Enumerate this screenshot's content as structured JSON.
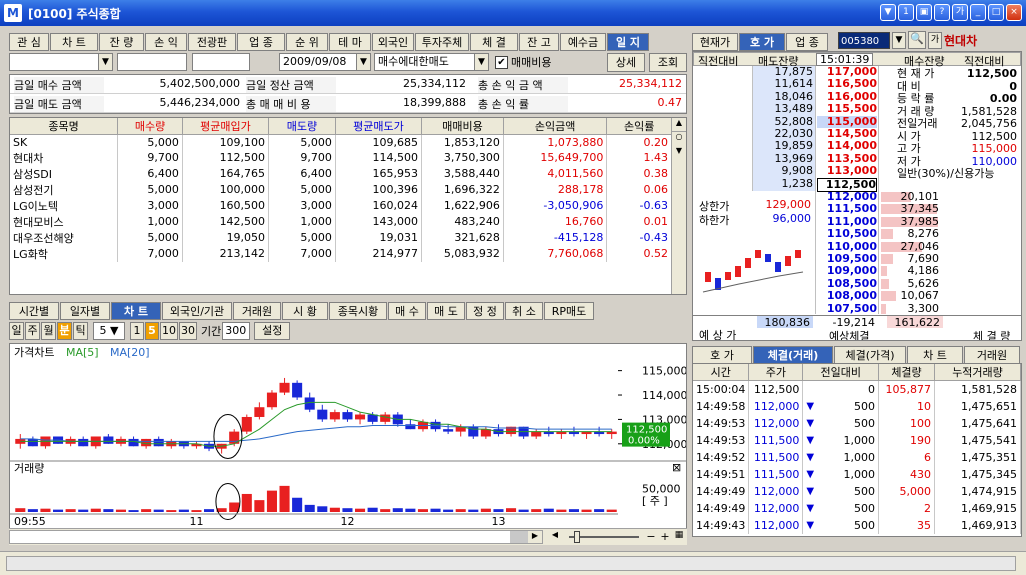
{
  "window": {
    "title": "[0100] 주식종합",
    "logo": "M",
    "controls": [
      "▼",
      "1",
      "▣",
      "?",
      "가",
      "_",
      "□",
      "×"
    ]
  },
  "left_tabs": [
    "관 심",
    "차 트",
    "잔 량",
    "손 익",
    "전광판",
    "업 종",
    "순 위",
    "테 마",
    "외국인",
    "투자주체",
    "체 결",
    "잔 고",
    "예수금",
    "일 지"
  ],
  "left_tabs_active": 13,
  "filter": {
    "account": "",
    "f2": "",
    "f3": "",
    "date": "2009/09/08",
    "mode": "매수에대한매도",
    "checkbox_label": "매매비용",
    "checked": true,
    "detail_btn": "상세",
    "query_btn": "조회"
  },
  "summary": {
    "row1": {
      "l1": "금일 매수 금액",
      "v1": "5,402,500,000",
      "l2": "금일 정산 금액",
      "v2": "25,334,112",
      "l3": "총 손 익 금 액",
      "v3": "25,334,112"
    },
    "row2": {
      "l1": "금일 매도 금액",
      "v1": "5,446,234,000",
      "l2": "총 매 매 비 용",
      "v2": "18,399,888",
      "l3": "총 손 익 률",
      "v3": "0.47"
    }
  },
  "holdings": {
    "columns": [
      "종목명",
      "매수량",
      "평균매입가",
      "매도량",
      "평균매도가",
      "매매비용",
      "손익금액",
      "손익률"
    ],
    "rows": [
      [
        "SK",
        "5,000",
        "109,100",
        "5,000",
        "109,685",
        "1,853,120",
        "1,073,880",
        "0.20"
      ],
      [
        "현대차",
        "9,700",
        "112,500",
        "9,700",
        "114,500",
        "3,750,300",
        "15,649,700",
        "1.43"
      ],
      [
        "삼성SDI",
        "6,400",
        "164,765",
        "6,400",
        "165,953",
        "3,588,440",
        "4,011,560",
        "0.38"
      ],
      [
        "삼성전기",
        "5,000",
        "100,000",
        "5,000",
        "100,396",
        "1,696,322",
        "288,178",
        "0.06"
      ],
      [
        "LG이노텍",
        "3,000",
        "160,500",
        "3,000",
        "160,024",
        "1,622,906",
        "-3,050,906",
        "-0.63"
      ],
      [
        "현대모비스",
        "1,000",
        "142,500",
        "1,000",
        "143,000",
        "483,240",
        "16,760",
        "0.01"
      ],
      [
        "대우조선해양",
        "5,000",
        "19,050",
        "5,000",
        "19,031",
        "321,628",
        "-415,128",
        "-0.43"
      ],
      [
        "LG화학",
        "7,000",
        "213,142",
        "7,000",
        "214,977",
        "5,083,932",
        "7,760,068",
        "0.52"
      ]
    ]
  },
  "bottom_tabs": [
    "시간별",
    "일자별",
    "차 트",
    "외국인/기관",
    "거래원",
    "시 황",
    "종목시황",
    "매 수",
    "매 도",
    "정 정",
    "취 소",
    "RP매도"
  ],
  "bottom_tabs_active": 2,
  "chart_toolbar": {
    "periods": [
      "일",
      "주",
      "월",
      "분",
      "틱"
    ],
    "active_period": 3,
    "select": "5",
    "nums": [
      "1",
      "5",
      "10",
      "30"
    ],
    "active_num": 1,
    "range_label": "기간",
    "range_value": "300",
    "settings": "설정"
  },
  "chart_data": [
    {
      "type": "candlestick",
      "title": "가격차트",
      "legend": [
        "MA[5]",
        "MA[20]"
      ],
      "y_ticks": [
        "115,000",
        "114,000",
        "113,000",
        "112,000"
      ],
      "ylim": [
        111500,
        115600
      ],
      "last_price": "112,500",
      "last_change": "0.00%",
      "x_ticks": [
        "09:55",
        "11",
        "12",
        "13"
      ],
      "candles": [
        [
          112000,
          112400,
          111800,
          112200
        ],
        [
          112200,
          112300,
          111900,
          111900
        ],
        [
          111900,
          112300,
          111800,
          112300
        ],
        [
          112300,
          112300,
          112000,
          112000
        ],
        [
          112000,
          112300,
          111900,
          112200
        ],
        [
          112200,
          112300,
          111900,
          111900
        ],
        [
          111900,
          112300,
          111800,
          112300
        ],
        [
          112300,
          112400,
          112000,
          112000
        ],
        [
          112000,
          112300,
          111900,
          112200
        ],
        [
          112200,
          112300,
          111900,
          111900
        ],
        [
          111900,
          112200,
          111800,
          112200
        ],
        [
          112200,
          112300,
          111900,
          111900
        ],
        [
          111900,
          112200,
          111800,
          112100
        ],
        [
          112100,
          112100,
          111800,
          111900
        ],
        [
          111900,
          112100,
          111800,
          112000
        ],
        [
          112000,
          112100,
          111700,
          111800
        ],
        [
          111800,
          112000,
          111600,
          112000
        ],
        [
          112000,
          112600,
          111900,
          112500
        ],
        [
          112500,
          113200,
          112400,
          113100
        ],
        [
          113100,
          113700,
          113000,
          113500
        ],
        [
          113500,
          114200,
          113400,
          114100
        ],
        [
          114100,
          114700,
          114000,
          114500
        ],
        [
          114500,
          114600,
          113800,
          113900
        ],
        [
          113900,
          114100,
          113300,
          113400
        ],
        [
          113400,
          113600,
          112900,
          113000
        ],
        [
          113000,
          113400,
          112900,
          113300
        ],
        [
          113300,
          113400,
          112900,
          113000
        ],
        [
          113000,
          113300,
          112800,
          113200
        ],
        [
          113200,
          113300,
          112800,
          112900
        ],
        [
          112900,
          113300,
          112800,
          113200
        ],
        [
          113200,
          113300,
          112700,
          112800
        ],
        [
          112800,
          113000,
          112600,
          112600
        ],
        [
          112600,
          113000,
          112500,
          112900
        ],
        [
          112900,
          113000,
          112500,
          112600
        ],
        [
          112600,
          112800,
          112400,
          112500
        ],
        [
          112500,
          112800,
          112300,
          112700
        ],
        [
          112700,
          112800,
          112200,
          112300
        ],
        [
          112300,
          112700,
          112200,
          112600
        ],
        [
          112600,
          112800,
          112300,
          112400
        ],
        [
          112400,
          112700,
          112300,
          112700
        ],
        [
          112700,
          112700,
          112200,
          112300
        ],
        [
          112300,
          112600,
          112200,
          112500
        ],
        [
          112500,
          112700,
          112300,
          112400
        ],
        [
          112400,
          112600,
          112200,
          112500
        ],
        [
          112500,
          112700,
          112300,
          112400
        ],
        [
          112400,
          112500,
          112200,
          112500
        ],
        [
          112500,
          112700,
          112300,
          112400
        ],
        [
          112400,
          112600,
          112200,
          112500
        ]
      ],
      "ma5": [
        112100,
        112100,
        112100,
        112100,
        112100,
        112100,
        112100,
        112100,
        112100,
        112100,
        112000,
        112000,
        112000,
        112000,
        112000,
        111900,
        111900,
        112000,
        112300,
        112600,
        113000,
        113400,
        113600,
        113700,
        113700,
        113700,
        113500,
        113300,
        113200,
        113100,
        113000,
        113000,
        112900,
        112800,
        112800,
        112700,
        112600,
        112600,
        112500,
        112500,
        112500,
        112500,
        112500,
        112500,
        112500,
        112500,
        112500,
        112500
      ],
      "ma20": [
        112200,
        112200,
        112150,
        112150,
        112100,
        112100,
        112100,
        112100,
        112100,
        112100,
        112100,
        112100,
        112100,
        112100,
        112100,
        112100,
        112100,
        112100,
        112150,
        112200,
        112300,
        112400,
        112500,
        112550,
        112600,
        112650,
        112700,
        112700,
        112750,
        112750,
        112750,
        112750,
        112750,
        112750,
        112700,
        112700,
        112700,
        112700,
        112650,
        112650,
        112650,
        112600,
        112600,
        112600,
        112600,
        112600,
        112600,
        112600
      ]
    },
    {
      "type": "bar",
      "title": "거래량",
      "y_tick": "50,000",
      "unit": "[ 주 ]",
      "ylim": [
        0,
        80000
      ],
      "values": [
        8000,
        6000,
        7000,
        5000,
        6000,
        5000,
        7000,
        6000,
        5000,
        4000,
        6000,
        5000,
        4000,
        5000,
        4000,
        6000,
        8000,
        20000,
        38000,
        25000,
        45000,
        55000,
        30000,
        15000,
        12000,
        9000,
        8000,
        7000,
        9000,
        6000,
        8000,
        7000,
        6000,
        7000,
        5000,
        6000,
        5000,
        7000,
        6000,
        8000,
        5000,
        6000,
        7000,
        5000,
        6000,
        5000,
        6000,
        5000
      ],
      "up": [
        1,
        0,
        1,
        0,
        1,
        0,
        1,
        0,
        1,
        0,
        1,
        0,
        1,
        0,
        1,
        0,
        1,
        1,
        1,
        1,
        1,
        1,
        0,
        0,
        0,
        1,
        0,
        1,
        0,
        1,
        0,
        0,
        1,
        0,
        0,
        1,
        0,
        1,
        0,
        1,
        0,
        1,
        0,
        1,
        0,
        1,
        0,
        1
      ]
    }
  ],
  "chart_legend": {
    "title": "가격차트",
    "ma5": "MA[5]",
    "ma20": "MA[20]",
    "vol_title": "거래량",
    "vol_tick": "50,000",
    "vol_unit": "[ 주 ]"
  },
  "right_tabs": [
    "현재가",
    "호 가",
    "업 종"
  ],
  "right_tabs_active": 1,
  "stock": {
    "code": "005380",
    "name": "현대차"
  },
  "orderbook_header": {
    "c1": "직전대비",
    "c2": "매도잔량",
    "time": "15:01:39",
    "c3": "매수잔량",
    "c4": "직전대비"
  },
  "ask_qty": [
    "17,875",
    "11,614",
    "18,046",
    "13,489",
    "52,808",
    "22,030",
    "19,859",
    "13,969",
    "9,908",
    "1,238"
  ],
  "ask_price": [
    "117,000",
    "116,500",
    "116,000",
    "115,500",
    "115,000",
    "114,500",
    "114,000",
    "113,500",
    "113,000",
    "112,500"
  ],
  "bid_price": [
    "112,000",
    "111,500",
    "111,000",
    "110,500",
    "110,000",
    "109,500",
    "109,000",
    "108,500",
    "108,000",
    "107,500"
  ],
  "bid_qty": [
    "20,101",
    "37,345",
    "37,985",
    "8,276",
    "27,046",
    "7,690",
    "4,186",
    "5,626",
    "10,067",
    "3,300"
  ],
  "info": [
    {
      "k": "현 재 가",
      "v": "112,500",
      "cls": ""
    },
    {
      "k": "대    비",
      "v": "0",
      "cls": ""
    },
    {
      "k": "등 락 률",
      "v": "0.00",
      "cls": ""
    },
    {
      "k": "거 래 량",
      "v": "1,581,528",
      "cls": ""
    },
    {
      "k": "전일거래",
      "v": "2,045,756",
      "cls": ""
    },
    {
      "k": "시    가",
      "v": "112,500",
      "cls": ""
    },
    {
      "k": "고    가",
      "v": "115,000",
      "cls": "red"
    },
    {
      "k": "저    가",
      "v": "110,000",
      "cls": "blue"
    },
    {
      "k": "일반(30%)/신용가능",
      "v": "",
      "cls": ""
    }
  ],
  "limits": {
    "upper_label": "상한가",
    "upper": "129,000",
    "lower_label": "하한가",
    "lower": "96,000"
  },
  "ob_footer": {
    "label_left": "예 상 가",
    "total_ask": "180,836",
    "diff": "-19,214",
    "total_bid": "161,622",
    "label_mid": "예상체결",
    "label_right": "체 결 량"
  },
  "trade_tabs": [
    "호 가",
    "체결(거래)",
    "체결(가격)",
    "차 트",
    "거래원"
  ],
  "trade_tabs_active": 1,
  "trades": {
    "columns": [
      "시간",
      "주가",
      "전일대비",
      "체결량",
      "누적거래량"
    ],
    "rows": [
      [
        "15:00:04",
        "112,500",
        "",
        "0",
        "105,877",
        "1,581,528"
      ],
      [
        "14:49:58",
        "112,000",
        "▼",
        "500",
        "10",
        "1,475,651"
      ],
      [
        "14:49:53",
        "112,000",
        "▼",
        "500",
        "100",
        "1,475,641"
      ],
      [
        "14:49:53",
        "111,500",
        "▼",
        "1,000",
        "190",
        "1,475,541"
      ],
      [
        "14:49:52",
        "111,500",
        "▼",
        "1,000",
        "6",
        "1,475,351"
      ],
      [
        "14:49:51",
        "111,500",
        "▼",
        "1,000",
        "430",
        "1,475,345"
      ],
      [
        "14:49:49",
        "112,000",
        "▼",
        "500",
        "5,000",
        "1,474,915"
      ],
      [
        "14:49:49",
        "112,000",
        "▼",
        "500",
        "2",
        "1,469,915"
      ],
      [
        "14:49:43",
        "112,000",
        "▼",
        "500",
        "35",
        "1,469,913"
      ]
    ]
  }
}
